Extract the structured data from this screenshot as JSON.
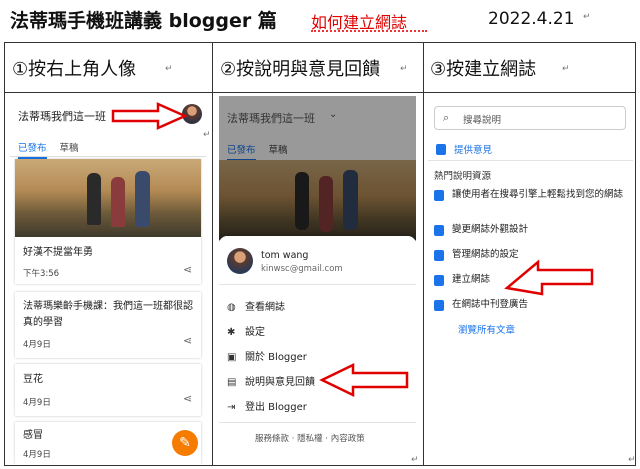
{
  "header": {
    "title": "法蒂瑪手機班講義 blogger 篇",
    "subtitle": "如何建立網誌",
    "date": "2022.4.21"
  },
  "columns": [
    {
      "heading": "①按右上角人像"
    },
    {
      "heading": "②按說明與意見回饋"
    },
    {
      "heading": "③按建立網誌"
    }
  ],
  "panel1": {
    "blog_name": "法蒂瑪我們這一班",
    "tabs": [
      "已發布",
      "草稿"
    ],
    "posts": [
      {
        "title": "好漢不提當年勇",
        "date": "下午3:56"
      },
      {
        "title": "法蒂瑪樂齡手機課：我們這一班都很認真的學習",
        "date": "4月9日"
      },
      {
        "title": "豆花",
        "date": "4月9日"
      },
      {
        "title": "感冒",
        "date": "4月9日"
      }
    ]
  },
  "panel2": {
    "blog_name": "法蒂瑪我們這一班",
    "tabs": [
      "已發布",
      "草稿"
    ],
    "user_name": "tom wang",
    "user_email": "kinwsc@gmail.com",
    "menu": [
      {
        "icon": "globe-icon",
        "label": "查看網誌"
      },
      {
        "icon": "gear-icon",
        "label": "設定"
      },
      {
        "icon": "blogger-icon",
        "label": "關於 Blogger"
      },
      {
        "icon": "feedback-icon",
        "label": "說明與意見回饋"
      },
      {
        "icon": "logout-icon",
        "label": "登出 Blogger"
      }
    ],
    "footer": "服務條款 · 隱私權 · 內容政策"
  },
  "panel3": {
    "search_placeholder": "搜尋說明",
    "feedback": "提供意見",
    "section_title": "熱門說明資源",
    "items": [
      "讓使用者在搜尋引擎上輕鬆找到您的網誌",
      "變更網誌外觀設計",
      "管理網誌的設定",
      "建立網誌",
      "在網誌中刊登廣告"
    ],
    "browse_all": "瀏覽所有文章"
  },
  "colors": {
    "accent": "#1a73e8",
    "arrow": "#e00000",
    "fab": "#f57c00"
  }
}
